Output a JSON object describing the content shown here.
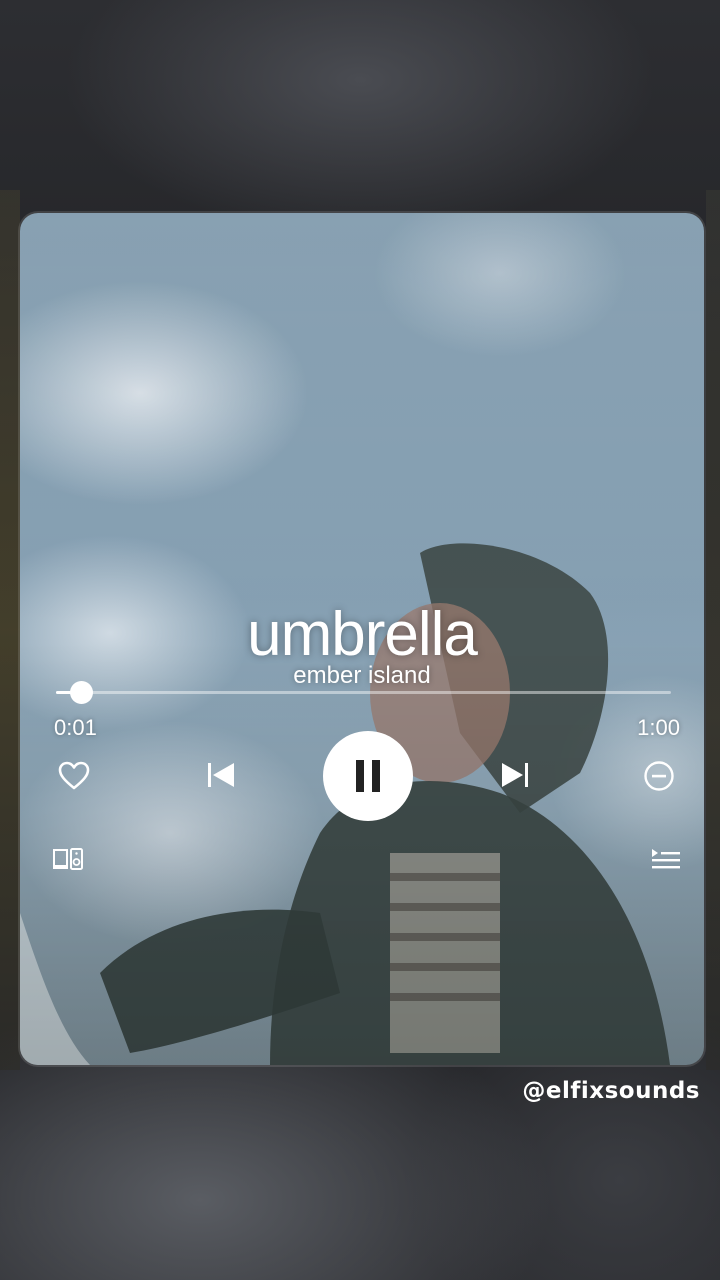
{
  "song": {
    "title": "umbrella",
    "artist": "ember island"
  },
  "playback": {
    "elapsed": "0:01",
    "duration": "1:00",
    "progress_fraction": 0.04,
    "state": "playing"
  },
  "controls": {
    "like_icon": "heart-icon",
    "previous_icon": "skip-previous-icon",
    "play_pause_icon": "pause-icon",
    "next_icon": "skip-next-icon",
    "remove_icon": "minus-circle-icon",
    "devices_icon": "devices-icon",
    "queue_icon": "queue-icon"
  },
  "watermark": "@elfixsounds",
  "colors": {
    "text": "#ffffff",
    "track": "#ffffff80",
    "sky": "#8fa9bb"
  }
}
